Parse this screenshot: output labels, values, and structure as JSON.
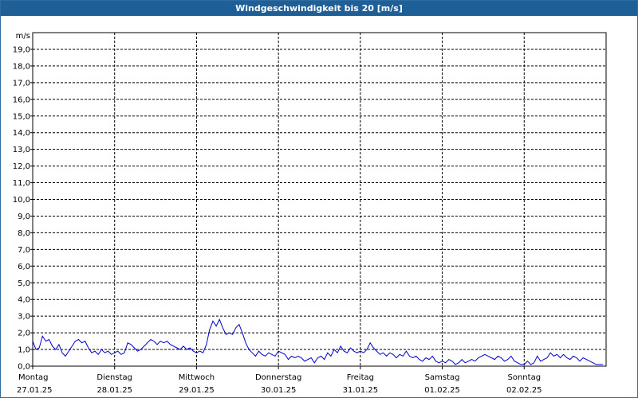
{
  "window": {
    "title": "Windgeschwindigkeit bis 20 [m/s]"
  },
  "colors": {
    "titlebar": "#1f5f98",
    "line": "#0000cc",
    "grid": "#000000"
  },
  "chart_data": {
    "type": "line",
    "title": "Windgeschwindigkeit bis 20 [m/s]",
    "ylabel": "m/s",
    "ylim": [
      0,
      20
    ],
    "yticks": [
      "0,0",
      "1,0",
      "2,0",
      "3,0",
      "4,0",
      "5,0",
      "6,0",
      "7,0",
      "8,0",
      "9,0",
      "10,0",
      "11,0",
      "12,0",
      "13,0",
      "14,0",
      "15,0",
      "16,0",
      "17,0",
      "18,0",
      "19,0"
    ],
    "xlim": [
      0,
      7
    ],
    "grid": true,
    "x_categories": [
      {
        "day": "Montag",
        "date": "27.01.25"
      },
      {
        "day": "Dienstag",
        "date": "28.01.25"
      },
      {
        "day": "Mittwoch",
        "date": "29.01.25"
      },
      {
        "day": "Donnerstag",
        "date": "30.01.25"
      },
      {
        "day": "Freitag",
        "date": "31.01.25"
      },
      {
        "day": "Samstag",
        "date": "01.02.25"
      },
      {
        "day": "Sonntag",
        "date": "02.02.25"
      }
    ],
    "series": [
      {
        "points": [
          [
            0.0,
            1.5
          ],
          [
            0.04,
            1.0
          ],
          [
            0.08,
            1.1
          ],
          [
            0.12,
            1.8
          ],
          [
            0.16,
            1.5
          ],
          [
            0.2,
            1.6
          ],
          [
            0.24,
            1.2
          ],
          [
            0.28,
            1.0
          ],
          [
            0.32,
            1.3
          ],
          [
            0.36,
            0.8
          ],
          [
            0.4,
            0.6
          ],
          [
            0.44,
            0.9
          ],
          [
            0.48,
            1.2
          ],
          [
            0.52,
            1.5
          ],
          [
            0.56,
            1.6
          ],
          [
            0.6,
            1.4
          ],
          [
            0.64,
            1.5
          ],
          [
            0.68,
            1.1
          ],
          [
            0.72,
            0.8
          ],
          [
            0.76,
            0.9
          ],
          [
            0.8,
            0.7
          ],
          [
            0.84,
            1.0
          ],
          [
            0.88,
            0.8
          ],
          [
            0.92,
            0.9
          ],
          [
            0.96,
            0.7
          ],
          [
            1.0,
            0.8
          ],
          [
            1.04,
            0.9
          ],
          [
            1.08,
            0.7
          ],
          [
            1.12,
            0.8
          ],
          [
            1.16,
            1.4
          ],
          [
            1.2,
            1.3
          ],
          [
            1.24,
            1.1
          ],
          [
            1.28,
            0.9
          ],
          [
            1.32,
            1.0
          ],
          [
            1.36,
            1.2
          ],
          [
            1.4,
            1.4
          ],
          [
            1.44,
            1.6
          ],
          [
            1.48,
            1.5
          ],
          [
            1.52,
            1.3
          ],
          [
            1.56,
            1.5
          ],
          [
            1.6,
            1.4
          ],
          [
            1.64,
            1.5
          ],
          [
            1.68,
            1.3
          ],
          [
            1.72,
            1.2
          ],
          [
            1.76,
            1.1
          ],
          [
            1.8,
            1.0
          ],
          [
            1.84,
            1.2
          ],
          [
            1.88,
            1.0
          ],
          [
            1.92,
            1.1
          ],
          [
            1.96,
            0.9
          ],
          [
            2.0,
            0.8
          ],
          [
            2.04,
            0.9
          ],
          [
            2.08,
            0.8
          ],
          [
            2.12,
            1.3
          ],
          [
            2.16,
            2.2
          ],
          [
            2.2,
            2.7
          ],
          [
            2.24,
            2.4
          ],
          [
            2.28,
            2.8
          ],
          [
            2.32,
            2.3
          ],
          [
            2.36,
            1.9
          ],
          [
            2.4,
            2.0
          ],
          [
            2.44,
            1.9
          ],
          [
            2.48,
            2.3
          ],
          [
            2.52,
            2.5
          ],
          [
            2.56,
            2.0
          ],
          [
            2.6,
            1.4
          ],
          [
            2.64,
            1.0
          ],
          [
            2.68,
            0.8
          ],
          [
            2.72,
            0.6
          ],
          [
            2.76,
            0.9
          ],
          [
            2.8,
            0.7
          ],
          [
            2.84,
            0.6
          ],
          [
            2.88,
            0.8
          ],
          [
            2.92,
            0.7
          ],
          [
            2.96,
            0.6
          ],
          [
            3.0,
            0.9
          ],
          [
            3.04,
            0.8
          ],
          [
            3.08,
            0.7
          ],
          [
            3.12,
            0.4
          ],
          [
            3.16,
            0.6
          ],
          [
            3.2,
            0.5
          ],
          [
            3.24,
            0.6
          ],
          [
            3.28,
            0.5
          ],
          [
            3.32,
            0.3
          ],
          [
            3.36,
            0.4
          ],
          [
            3.4,
            0.5
          ],
          [
            3.44,
            0.2
          ],
          [
            3.48,
            0.5
          ],
          [
            3.52,
            0.6
          ],
          [
            3.56,
            0.4
          ],
          [
            3.6,
            0.8
          ],
          [
            3.64,
            0.6
          ],
          [
            3.68,
            1.0
          ],
          [
            3.72,
            0.8
          ],
          [
            3.76,
            1.2
          ],
          [
            3.8,
            0.9
          ],
          [
            3.84,
            0.8
          ],
          [
            3.88,
            1.1
          ],
          [
            3.92,
            0.9
          ],
          [
            3.96,
            0.8
          ],
          [
            4.0,
            0.9
          ],
          [
            4.04,
            0.8
          ],
          [
            4.08,
            1.0
          ],
          [
            4.12,
            1.4
          ],
          [
            4.16,
            1.1
          ],
          [
            4.2,
            0.9
          ],
          [
            4.24,
            0.7
          ],
          [
            4.28,
            0.8
          ],
          [
            4.32,
            0.6
          ],
          [
            4.36,
            0.8
          ],
          [
            4.4,
            0.7
          ],
          [
            4.44,
            0.5
          ],
          [
            4.48,
            0.7
          ],
          [
            4.52,
            0.6
          ],
          [
            4.56,
            0.9
          ],
          [
            4.6,
            0.6
          ],
          [
            4.64,
            0.5
          ],
          [
            4.68,
            0.6
          ],
          [
            4.72,
            0.4
          ],
          [
            4.76,
            0.3
          ],
          [
            4.8,
            0.5
          ],
          [
            4.84,
            0.4
          ],
          [
            4.88,
            0.6
          ],
          [
            4.92,
            0.3
          ],
          [
            4.96,
            0.2
          ],
          [
            5.0,
            0.3
          ],
          [
            5.04,
            0.2
          ],
          [
            5.08,
            0.4
          ],
          [
            5.12,
            0.3
          ],
          [
            5.16,
            0.1
          ],
          [
            5.2,
            0.2
          ],
          [
            5.24,
            0.4
          ],
          [
            5.28,
            0.2
          ],
          [
            5.32,
            0.3
          ],
          [
            5.36,
            0.4
          ],
          [
            5.4,
            0.3
          ],
          [
            5.44,
            0.5
          ],
          [
            5.48,
            0.6
          ],
          [
            5.52,
            0.7
          ],
          [
            5.56,
            0.6
          ],
          [
            5.6,
            0.5
          ],
          [
            5.64,
            0.4
          ],
          [
            5.68,
            0.6
          ],
          [
            5.72,
            0.5
          ],
          [
            5.76,
            0.3
          ],
          [
            5.8,
            0.4
          ],
          [
            5.84,
            0.6
          ],
          [
            5.88,
            0.3
          ],
          [
            5.92,
            0.2
          ],
          [
            5.96,
            0.1
          ],
          [
            6.0,
            0.1
          ],
          [
            6.04,
            0.3
          ],
          [
            6.08,
            0.1
          ],
          [
            6.12,
            0.2
          ],
          [
            6.16,
            0.6
          ],
          [
            6.2,
            0.3
          ],
          [
            6.24,
            0.4
          ],
          [
            6.28,
            0.5
          ],
          [
            6.32,
            0.8
          ],
          [
            6.36,
            0.6
          ],
          [
            6.4,
            0.7
          ],
          [
            6.44,
            0.5
          ],
          [
            6.48,
            0.7
          ],
          [
            6.52,
            0.5
          ],
          [
            6.56,
            0.4
          ],
          [
            6.6,
            0.6
          ],
          [
            6.64,
            0.5
          ],
          [
            6.68,
            0.3
          ],
          [
            6.72,
            0.5
          ],
          [
            6.76,
            0.4
          ],
          [
            6.8,
            0.3
          ],
          [
            6.84,
            0.2
          ],
          [
            6.88,
            0.1
          ],
          [
            6.92,
            0.1
          ],
          [
            6.96,
            0.1
          ]
        ]
      }
    ]
  }
}
